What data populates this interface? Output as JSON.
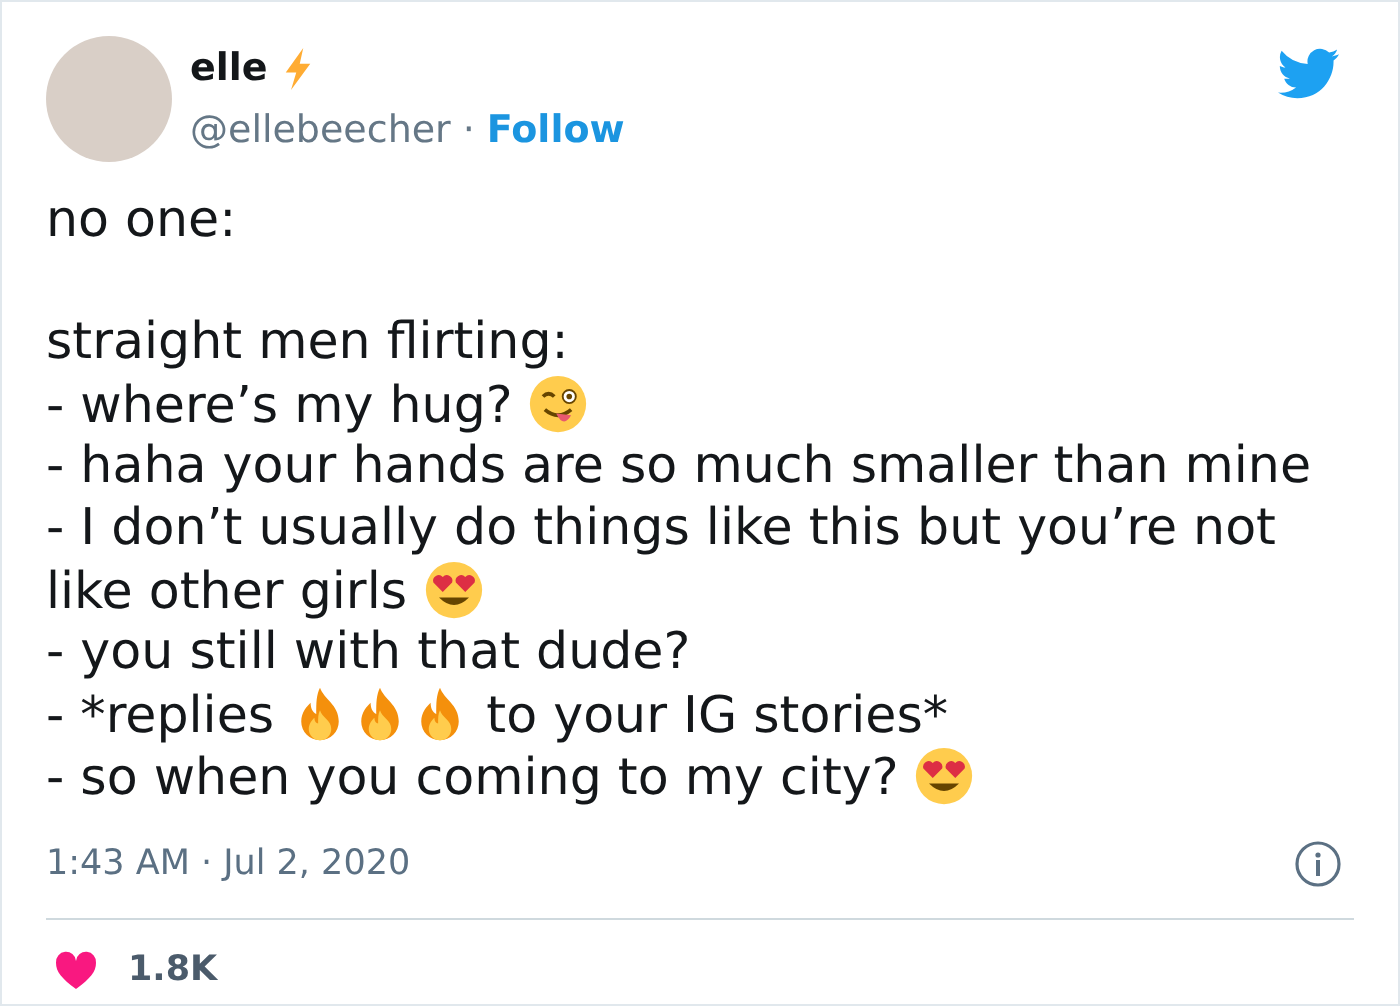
{
  "author": {
    "name": "elle",
    "handle": "@ellebeecher",
    "separator": "·",
    "follow": "Follow"
  },
  "body": [
    [
      [
        {
          "kind": "text",
          "text": "no one:"
        }
      ]
    ],
    [
      [
        {
          "kind": "text",
          "text": "straight men flirting:"
        }
      ],
      [
        {
          "kind": "text",
          "text": "- where’s my hug? "
        },
        {
          "kind": "wink"
        }
      ],
      [
        {
          "kind": "text",
          "text": "- haha your hands are so much smaller than mine"
        }
      ],
      [
        {
          "kind": "text",
          "text": "- I don’t usually do things like this but you’re not like other girls "
        },
        {
          "kind": "hearteyes"
        }
      ],
      [
        {
          "kind": "text",
          "text": "- you still with that dude?"
        }
      ],
      [
        {
          "kind": "text",
          "text": "- *replies "
        },
        {
          "kind": "fire"
        },
        {
          "kind": "fire"
        },
        {
          "kind": "fire"
        },
        {
          "kind": "text",
          "text": " to your IG stories*"
        }
      ],
      [
        {
          "kind": "text",
          "text": "- so when you coming to my city? "
        },
        {
          "kind": "hearteyes"
        }
      ]
    ]
  ],
  "timestamp": "1:43 AM · Jul 2, 2020",
  "likes": "1.8K"
}
